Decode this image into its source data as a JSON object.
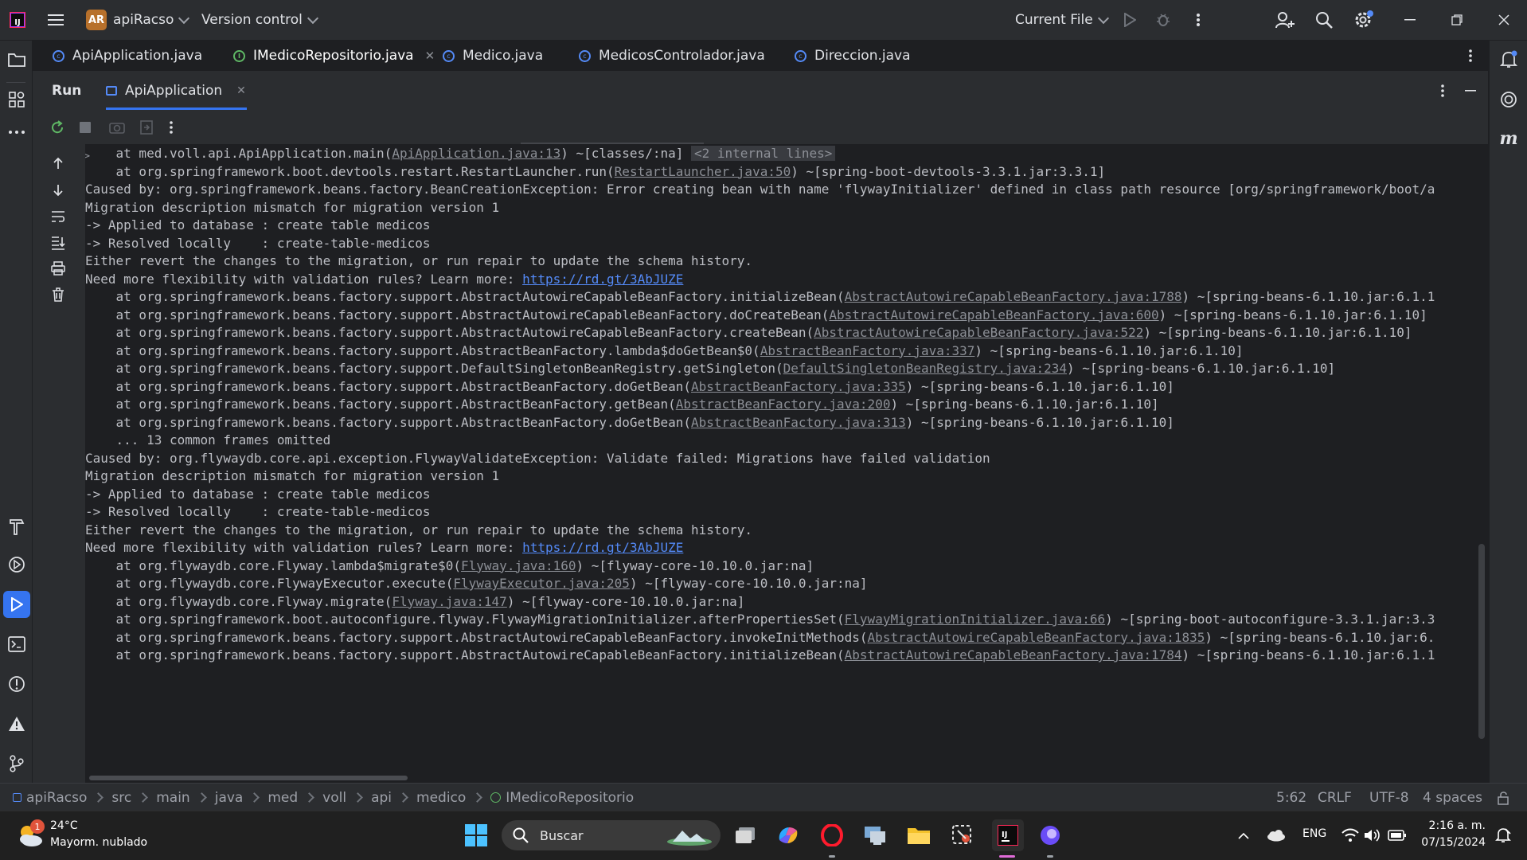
{
  "titlebar": {
    "project_initials": "AR",
    "project_name": "apiRacso",
    "vcs_label": "Version control",
    "run_config": "Current File"
  },
  "tabs": [
    {
      "label": "ApiApplication.java",
      "kind": "class"
    },
    {
      "label": "IMedicoRepositorio.java",
      "kind": "interface",
      "active": true
    },
    {
      "label": "Medico.java",
      "kind": "class"
    },
    {
      "label": "MedicosControlador.java",
      "kind": "class"
    },
    {
      "label": "Direccion.java",
      "kind": "class"
    }
  ],
  "run_panel": {
    "title": "Run",
    "tab_label": "ApiApplication"
  },
  "console_lines": [
    {
      "pre": "    at med.voll.api.ApiApplication.main(",
      "link": "ApiApplication.java:13",
      "post": ") ~[classes/:na] ",
      "chip": "<2 internal lines>"
    },
    {
      "pre": "    at org.springframework.boot.devtools.restart.RestartLauncher.run(",
      "link": "RestartLauncher.java:50",
      "post": ") ~[spring-boot-devtools-3.3.1.jar:3.3.1]"
    },
    {
      "pre": "Caused by: org.springframework.beans.factory.BeanCreationException: Error creating bean with name 'flywayInitializer' defined in class path resource [org/springframework/boot/a"
    },
    {
      "pre": "Migration description mismatch for migration version 1"
    },
    {
      "pre": "-> Applied to database : create table medicos"
    },
    {
      "pre": "-> Resolved locally    : create-table-medicos"
    },
    {
      "pre": "Either revert the changes to the migration, or run repair to update the schema history."
    },
    {
      "pre": "Need more flexibility with validation rules? Learn more: ",
      "url": "https://rd.gt/3AbJUZE"
    },
    {
      "pre": "    at org.springframework.beans.factory.support.AbstractAutowireCapableBeanFactory.initializeBean(",
      "link": "AbstractAutowireCapableBeanFactory.java:1788",
      "post": ") ~[spring-beans-6.1.10.jar:6.1.1"
    },
    {
      "pre": "    at org.springframework.beans.factory.support.AbstractAutowireCapableBeanFactory.doCreateBean(",
      "link": "AbstractAutowireCapableBeanFactory.java:600",
      "post": ") ~[spring-beans-6.1.10.jar:6.1.10]"
    },
    {
      "pre": "    at org.springframework.beans.factory.support.AbstractAutowireCapableBeanFactory.createBean(",
      "link": "AbstractAutowireCapableBeanFactory.java:522",
      "post": ") ~[spring-beans-6.1.10.jar:6.1.10]"
    },
    {
      "pre": "    at org.springframework.beans.factory.support.AbstractBeanFactory.lambda$doGetBean$0(",
      "link": "AbstractBeanFactory.java:337",
      "post": ") ~[spring-beans-6.1.10.jar:6.1.10]"
    },
    {
      "pre": "    at org.springframework.beans.factory.support.DefaultSingletonBeanRegistry.getSingleton(",
      "link": "DefaultSingletonBeanRegistry.java:234",
      "post": ") ~[spring-beans-6.1.10.jar:6.1.10]"
    },
    {
      "pre": "    at org.springframework.beans.factory.support.AbstractBeanFactory.doGetBean(",
      "link": "AbstractBeanFactory.java:335",
      "post": ") ~[spring-beans-6.1.10.jar:6.1.10]"
    },
    {
      "pre": "    at org.springframework.beans.factory.support.AbstractBeanFactory.getBean(",
      "link": "AbstractBeanFactory.java:200",
      "post": ") ~[spring-beans-6.1.10.jar:6.1.10]"
    },
    {
      "pre": "    at org.springframework.beans.factory.support.AbstractBeanFactory.doGetBean(",
      "link": "AbstractBeanFactory.java:313",
      "post": ") ~[spring-beans-6.1.10.jar:6.1.10]"
    },
    {
      "pre": "    ... 13 common frames omitted"
    },
    {
      "pre": "Caused by: org.flywaydb.core.api.exception.FlywayValidateException: Validate failed: Migrations have failed validation"
    },
    {
      "pre": "Migration description mismatch for migration version 1"
    },
    {
      "pre": "-> Applied to database : create table medicos"
    },
    {
      "pre": "-> Resolved locally    : create-table-medicos"
    },
    {
      "pre": "Either revert the changes to the migration, or run repair to update the schema history."
    },
    {
      "pre": "Need more flexibility with validation rules? Learn more: ",
      "url": "https://rd.gt/3AbJUZE"
    },
    {
      "pre": "    at org.flywaydb.core.Flyway.lambda$migrate$0(",
      "link": "Flyway.java:160",
      "post": ") ~[flyway-core-10.10.0.jar:na]"
    },
    {
      "pre": "    at org.flywaydb.core.FlywayExecutor.execute(",
      "link": "FlywayExecutor.java:205",
      "post": ") ~[flyway-core-10.10.0.jar:na]"
    },
    {
      "pre": "    at org.flywaydb.core.Flyway.migrate(",
      "link": "Flyway.java:147",
      "post": ") ~[flyway-core-10.10.0.jar:na]"
    },
    {
      "pre": "    at org.springframework.boot.autoconfigure.flyway.FlywayMigrationInitializer.afterPropertiesSet(",
      "link": "FlywayMigrationInitializer.java:66",
      "post": ") ~[spring-boot-autoconfigure-3.3.1.jar:3.3"
    },
    {
      "pre": "    at org.springframework.beans.factory.support.AbstractAutowireCapableBeanFactory.invokeInitMethods(",
      "link": "AbstractAutowireCapableBeanFactory.java:1835",
      "post": ") ~[spring-beans-6.1.10.jar:6."
    },
    {
      "pre": "    at org.springframework.beans.factory.support.AbstractAutowireCapableBeanFactory.initializeBean(",
      "link": "AbstractAutowireCapableBeanFactory.java:1784",
      "post": ") ~[spring-beans-6.1.10.jar:6.1.1"
    }
  ],
  "breadcrumb": [
    "apiRacso",
    "src",
    "main",
    "java",
    "med",
    "voll",
    "api",
    "medico",
    "IMedicoRepositorio"
  ],
  "status": {
    "position": "5:62",
    "line_sep": "CRLF",
    "encoding": "UTF-8",
    "indent": "4 spaces"
  },
  "taskbar": {
    "weather_temp": "24°C",
    "weather_desc": "Mayorm. nublado",
    "weather_badge": "1",
    "search_placeholder": "Buscar",
    "lang": "ENG",
    "time": "2:16 a. m.",
    "date": "07/15/2024"
  },
  "colors": {
    "accent": "#548af7",
    "bg": "#1e1f22",
    "panel": "#2b2d30",
    "project_badge": "#b7702b"
  }
}
